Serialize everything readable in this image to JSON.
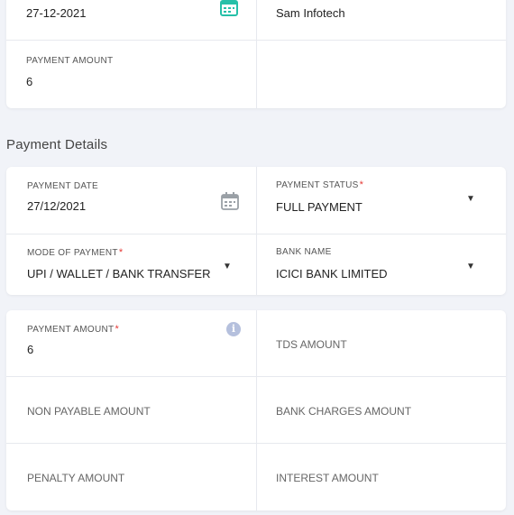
{
  "top_card": {
    "date_value": "27-12-2021",
    "company_value": "Sam Infotech",
    "payment_amount_label": "PAYMENT AMOUNT",
    "payment_amount_value": "6"
  },
  "section_title": "Payment Details",
  "details_card": {
    "payment_date_label": "PAYMENT DATE",
    "payment_date_value": "27/12/2021",
    "payment_status_label": "PAYMENT STATUS",
    "payment_status_value": "FULL PAYMENT",
    "mode_label": "MODE OF PAYMENT",
    "mode_value": "UPI / WALLET / BANK TRANSFER",
    "bank_label": "BANK NAME",
    "bank_value": "ICICI BANK LIMITED",
    "required_mark": "*",
    "caret": "▼"
  },
  "amounts_card": {
    "payment_amount_label": "PAYMENT AMOUNT",
    "payment_amount_value": "6",
    "tds_placeholder": "TDS AMOUNT",
    "non_payable_placeholder": "NON PAYABLE AMOUNT",
    "bank_charges_placeholder": "BANK CHARGES AMOUNT",
    "penalty_placeholder": "PENALTY AMOUNT",
    "interest_placeholder": "INTEREST AMOUNT",
    "info_glyph": "i"
  },
  "colors": {
    "accent_calendar": "#26c0a8",
    "icon_grey": "#9aa0a6",
    "info_badge": "#b5c0dd",
    "required": "#e53935"
  }
}
